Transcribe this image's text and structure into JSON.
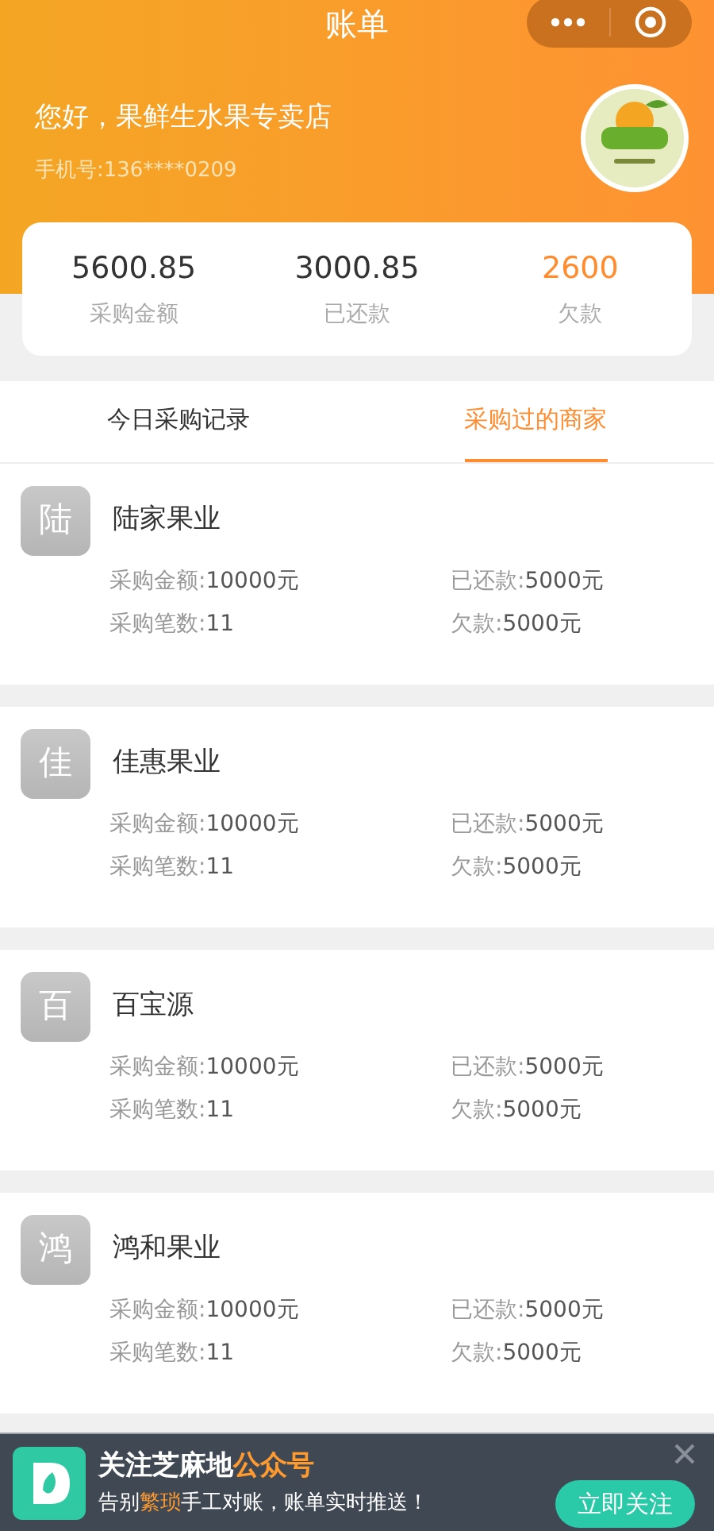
{
  "title": "账单",
  "greeting": "您好，果鲜生水果专卖店",
  "phone": "手机号:136****0209",
  "summary": [
    {
      "value": "5600.85",
      "label": "采购金额",
      "kind": "normal"
    },
    {
      "value": "3000.85",
      "label": "已还款",
      "kind": "normal"
    },
    {
      "value": "2600",
      "label": "欠款",
      "kind": "debt"
    }
  ],
  "tabs": [
    {
      "label": "今日采购记录",
      "selected": false
    },
    {
      "label": "采购过的商家",
      "selected": true
    }
  ],
  "merchants": [
    {
      "initial": "陆",
      "name": "陆家果业",
      "fields": [
        {
          "label": "采购金额:",
          "value": "10000元"
        },
        {
          "label": "已还款:",
          "value": "5000元"
        },
        {
          "label": "采购笔数:",
          "value": "11"
        },
        {
          "label": "欠款:",
          "value": "5000元"
        }
      ]
    },
    {
      "initial": "佳",
      "name": "佳惠果业",
      "fields": [
        {
          "label": "采购金额:",
          "value": "10000元"
        },
        {
          "label": "已还款:",
          "value": "5000元"
        },
        {
          "label": "采购笔数:",
          "value": "11"
        },
        {
          "label": "欠款:",
          "value": "5000元"
        }
      ]
    },
    {
      "initial": "百",
      "name": "百宝源",
      "fields": [
        {
          "label": "采购金额:",
          "value": "10000元"
        },
        {
          "label": "已还款:",
          "value": "5000元"
        },
        {
          "label": "采购笔数:",
          "value": "11"
        },
        {
          "label": "欠款:",
          "value": "5000元"
        }
      ]
    },
    {
      "initial": "鸿",
      "name": "鸿和果业",
      "fields": [
        {
          "label": "采购金额:",
          "value": "10000元"
        },
        {
          "label": "已还款:",
          "value": "5000元"
        },
        {
          "label": "采购笔数:",
          "value": "11"
        },
        {
          "label": "欠款:",
          "value": "5000元"
        }
      ]
    }
  ],
  "banner": {
    "title": "关注芝麻地**公众号**",
    "subtitle": "告别**繁琐**手工对账，账单实时推送！",
    "button": "立即关注"
  }
}
